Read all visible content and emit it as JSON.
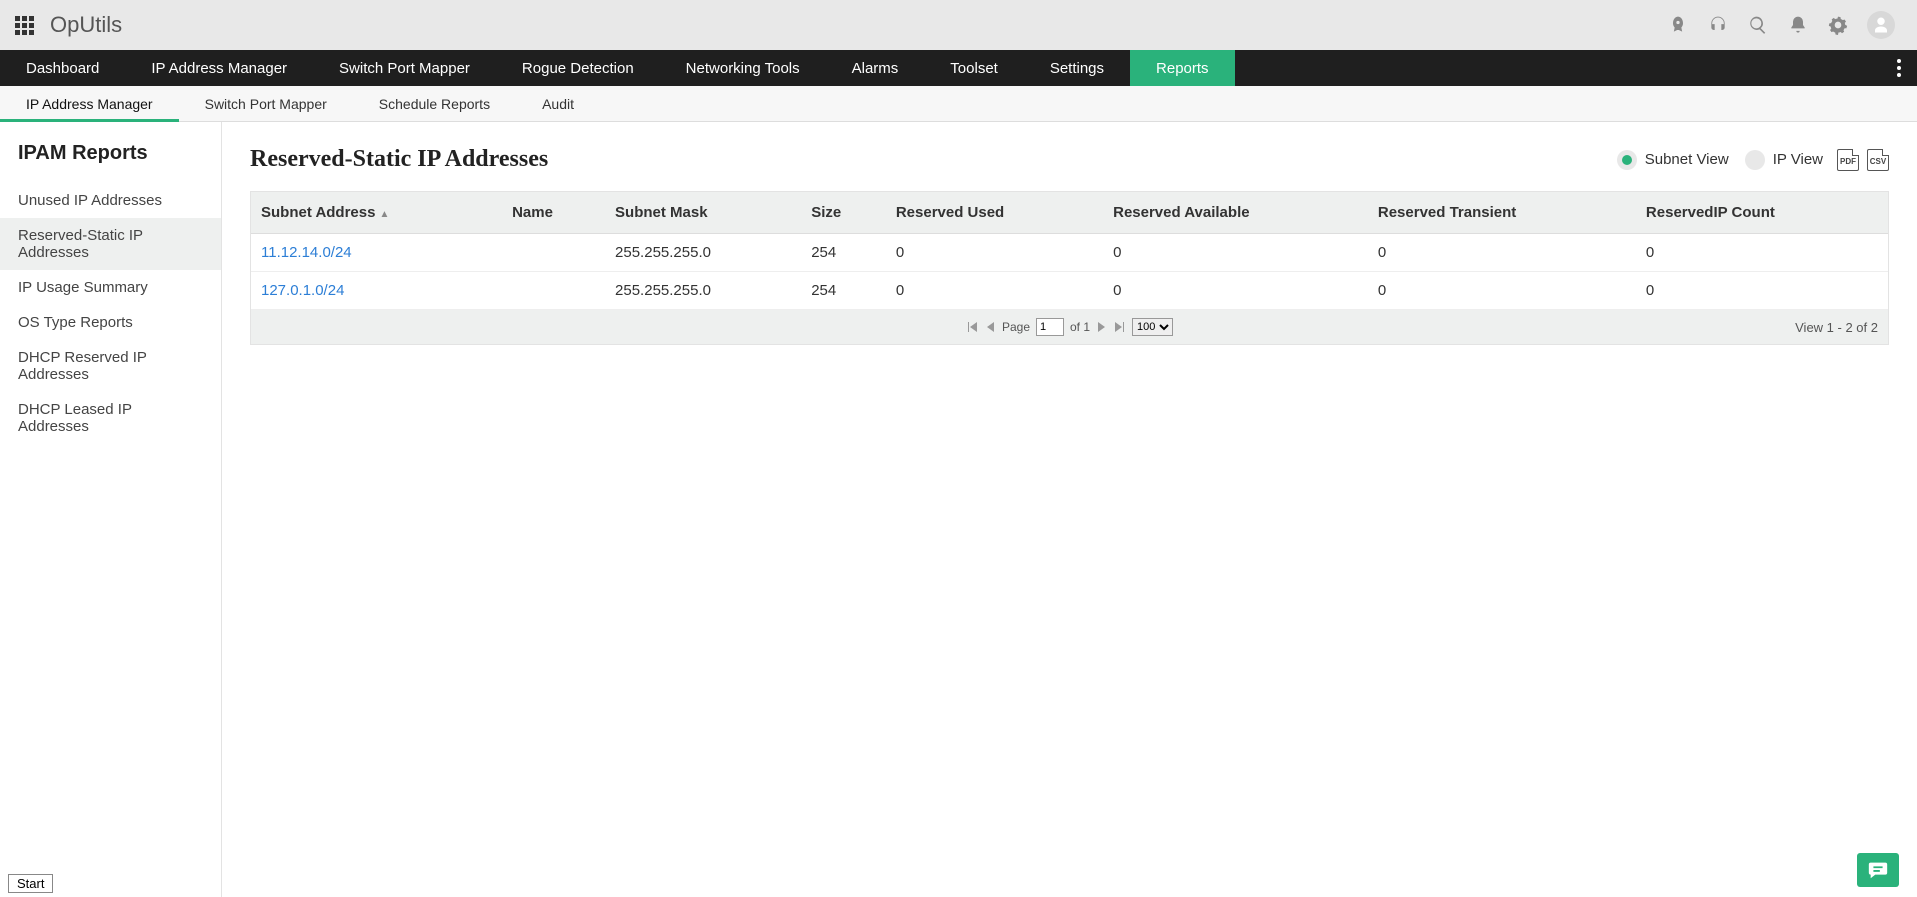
{
  "app": {
    "title": "OpUtils"
  },
  "primary_nav": {
    "items": [
      "Dashboard",
      "IP Address Manager",
      "Switch Port Mapper",
      "Rogue Detection",
      "Networking Tools",
      "Alarms",
      "Toolset",
      "Settings",
      "Reports"
    ],
    "active_index": 8
  },
  "sub_nav": {
    "items": [
      "IP Address Manager",
      "Switch Port Mapper",
      "Schedule Reports",
      "Audit"
    ],
    "active_index": 0
  },
  "sidebar": {
    "title": "IPAM Reports",
    "items": [
      "Unused IP Addresses",
      "Reserved-Static IP Addresses",
      "IP Usage Summary",
      "OS Type Reports",
      "DHCP Reserved IP Addresses",
      "DHCP Leased IP Addresses"
    ],
    "active_index": 1
  },
  "main": {
    "title": "Reserved-Static IP Addresses",
    "view_toggle": {
      "subnet": "Subnet View",
      "ip": "IP View",
      "selected": "subnet"
    },
    "export": {
      "pdf": "PDF",
      "csv": "CSV"
    },
    "table": {
      "headers": [
        "Subnet Address",
        "Name",
        "Subnet Mask",
        "Size",
        "Reserved Used",
        "Reserved Available",
        "Reserved Transient",
        "ReservedIP Count"
      ],
      "rows": [
        {
          "subnet": "11.12.14.0/24",
          "name": "",
          "mask": "255.255.255.0",
          "size": "254",
          "used": "0",
          "available": "0",
          "transient": "0",
          "count": "0"
        },
        {
          "subnet": "127.0.1.0/24",
          "name": "",
          "mask": "255.255.255.0",
          "size": "254",
          "used": "0",
          "available": "0",
          "transient": "0",
          "count": "0"
        }
      ]
    },
    "pager": {
      "page_label": "Page",
      "page": "1",
      "of_label": "of 1",
      "page_size": "100",
      "page_size_options": [
        "100"
      ],
      "view_text": "View 1 - 2 of 2"
    }
  },
  "footer": {
    "start": "Start"
  }
}
